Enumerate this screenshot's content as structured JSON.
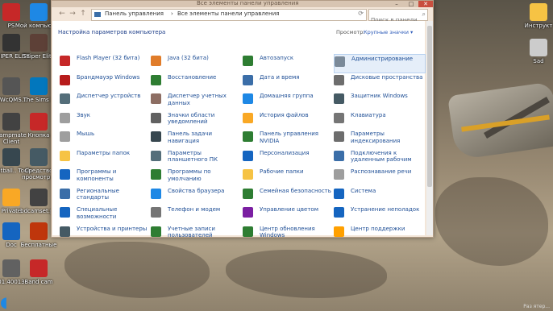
{
  "window": {
    "title": "Все элементы панели управления",
    "address": [
      "Панель управления",
      "Все элементы панели управления"
    ],
    "search_placeholder": "Поиск в панели управл...",
    "controls": [
      "–",
      "□",
      "✕"
    ],
    "header_title": "Настройка параметров компьютера",
    "view_label": "Просмотр:",
    "view_value": "Крупные значки ▾"
  },
  "items": [
    {
      "label": "Flash Player (32 бита)",
      "icon": "flash-icon",
      "color": "#c62828"
    },
    {
      "label": "Java (32 бита)",
      "icon": "java-icon",
      "color": "#e07c2a"
    },
    {
      "label": "Автозапуск",
      "icon": "autoplay-icon",
      "color": "#2e7d32"
    },
    {
      "label": "Администрирование",
      "icon": "admin-tools-icon",
      "color": "#7b8a99"
    },
    {
      "label": "Брандмауэр Windows",
      "icon": "firewall-icon",
      "color": "#b71c1c"
    },
    {
      "label": "Восстановление",
      "icon": "recovery-icon",
      "color": "#2e7d32"
    },
    {
      "label": "Дата и время",
      "icon": "clock-icon",
      "color": "#3b6ea8"
    },
    {
      "label": "Дисковые пространства",
      "icon": "storage-icon",
      "color": "#6d6d6d"
    },
    {
      "label": "Диспетчер устройств",
      "icon": "device-manager-icon",
      "color": "#546e7a"
    },
    {
      "label": "Диспетчер учетных данных",
      "icon": "credential-icon",
      "color": "#8d6e63"
    },
    {
      "label": "Домашняя группа",
      "icon": "homegroup-icon",
      "color": "#1e88e5"
    },
    {
      "label": "Защитник Windows",
      "icon": "defender-icon",
      "color": "#455a64"
    },
    {
      "label": "Звук",
      "icon": "sound-icon",
      "color": "#9e9e9e"
    },
    {
      "label": "Значки области уведомлений",
      "icon": "notification-icon",
      "color": "#616161"
    },
    {
      "label": "История файлов",
      "icon": "file-history-icon",
      "color": "#f9a825"
    },
    {
      "label": "Клавиатура",
      "icon": "keyboard-icon",
      "color": "#757575"
    },
    {
      "label": "Мышь",
      "icon": "mouse-icon",
      "color": "#9e9e9e"
    },
    {
      "label": "Панель задачи навигация",
      "icon": "taskbar-icon",
      "color": "#37474f"
    },
    {
      "label": "Панель управления NVIDIA",
      "icon": "nvidia-icon",
      "color": "#2e7d32"
    },
    {
      "label": "Параметры индексирования",
      "icon": "indexing-icon",
      "color": "#6d6d6d"
    },
    {
      "label": "Параметры папок",
      "icon": "folder-options-icon",
      "color": "#f6c344"
    },
    {
      "label": "Параметры планшетного ПК",
      "icon": "tablet-icon",
      "color": "#546e7a"
    },
    {
      "label": "Персонализация",
      "icon": "personalization-icon",
      "color": "#1565c0"
    },
    {
      "label": "Подключения к удаленным рабочим",
      "icon": "remote-icon",
      "color": "#3b6ea8"
    },
    {
      "label": "Программы и компоненты",
      "icon": "programs-icon",
      "color": "#1565c0"
    },
    {
      "label": "Программы по умолчанию",
      "icon": "default-programs-icon",
      "color": "#2e7d32"
    },
    {
      "label": "Рабочие папки",
      "icon": "work-folders-icon",
      "color": "#f6c344"
    },
    {
      "label": "Распознавание речи",
      "icon": "microphone-icon",
      "color": "#9e9e9e"
    },
    {
      "label": "Региональные стандарты",
      "icon": "region-icon",
      "color": "#3b6ea8"
    },
    {
      "label": "Свойства браузера",
      "icon": "browser-icon",
      "color": "#1e88e5"
    },
    {
      "label": "Семейная безопасность",
      "icon": "family-icon",
      "color": "#2e7d32"
    },
    {
      "label": "Система",
      "icon": "system-icon",
      "color": "#1565c0"
    },
    {
      "label": "Специальные возможности",
      "icon": "accessibility-icon",
      "color": "#1565c0"
    },
    {
      "label": "Телефон и модем",
      "icon": "phone-icon",
      "color": "#757575"
    },
    {
      "label": "Управление цветом",
      "icon": "color-management-icon",
      "color": "#7b1fa2"
    },
    {
      "label": "Устранение неполадок",
      "icon": "troubleshoot-icon",
      "color": "#1565c0"
    },
    {
      "label": "Устройства и принтеры",
      "icon": "printer-icon",
      "color": "#455a64"
    },
    {
      "label": "Учетные записи пользователей",
      "icon": "user-accounts-icon",
      "color": "#2e7d32"
    },
    {
      "label": "Центр обновления Windows",
      "icon": "update-icon",
      "color": "#2e7d32"
    },
    {
      "label": "Центр поддержки",
      "icon": "action-center-icon",
      "color": "#ffa000"
    }
  ],
  "desktop_left": [
    {
      "label": "PS",
      "color": "#c62828"
    },
    {
      "label": "Мой компьютер",
      "color": "#1e88e5"
    },
    {
      "label": "SNIPER ELITE",
      "color": "#333333"
    },
    {
      "label": "Sniper Elite",
      "color": "#5d4037"
    },
    {
      "label": "NWcQMS...",
      "color": "#555555"
    },
    {
      "label": "The Sims 3",
      "color": "#0277bd"
    },
    {
      "label": "campmate Client",
      "color": "#424242"
    },
    {
      "label": "Кнопка",
      "color": "#c62828"
    },
    {
      "label": "Football.. Tools",
      "color": "#37474f"
    },
    {
      "label": "Средство просмотр...",
      "color": "#455a64"
    },
    {
      "label": "Private",
      "color": "#f9a825"
    },
    {
      "label": "bdcamset.pd",
      "color": "#424242"
    },
    {
      "label": "Doc",
      "color": "#1565c0"
    },
    {
      "label": "Бесплатные",
      "color": "#bf360c"
    },
    {
      "label": "01.40013",
      "color": "#616161"
    },
    {
      "label": "Band cam",
      "color": "#c62828"
    }
  ],
  "desktop_right": [
    {
      "label": "Инструкт",
      "color": "#f6c344"
    },
    {
      "label": "Sad",
      "color": "#cccccc"
    }
  ],
  "tray_text": "Раз ятер..."
}
